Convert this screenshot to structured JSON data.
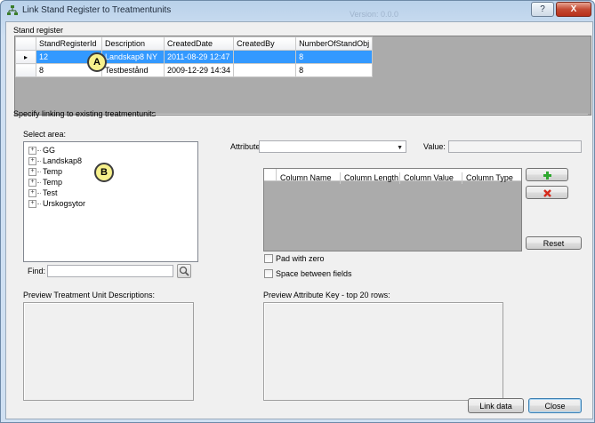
{
  "window": {
    "title": "Link Stand Register to Treatmentunits",
    "version": "Version: 0.0.0",
    "help_label": "?",
    "close_label": "X"
  },
  "stand_register": {
    "label": "Stand register",
    "columns": [
      "StandRegisterId",
      "Description",
      "CreatedDate",
      "CreatedBy",
      "NumberOfStandObj"
    ],
    "rows": [
      {
        "indicator": "▸",
        "id": "12",
        "description": "Landskap8 NY",
        "created_date": "2011-08-29 12:47",
        "created_by": "",
        "count": "8"
      },
      {
        "indicator": "",
        "id": "8",
        "description": "Testbestånd",
        "created_date": "2009-12-29 14:34",
        "created_by": "",
        "count": "8"
      }
    ]
  },
  "callouts": {
    "a": "A",
    "b": "B"
  },
  "linking": {
    "label": "Specify linking to existing treatmentunits",
    "select_area_label": "Select area:",
    "tree": [
      {
        "expander": "+",
        "label": "GG"
      },
      {
        "expander": "+",
        "label": "Landskap8"
      },
      {
        "expander": "+",
        "label": "Temp"
      },
      {
        "expander": "+",
        "label": "Temp"
      },
      {
        "expander": "+",
        "label": "Test"
      },
      {
        "expander": "+",
        "label": "Urskogsytor"
      }
    ],
    "find_label": "Find:",
    "find_value": "",
    "attribute_label": "Attribute:",
    "attribute_value": "",
    "value_label": "Value:",
    "value_value": "",
    "columns_grid": [
      "Column Name",
      "Column Length",
      "Column Value",
      "Column Type"
    ],
    "reset_label": "Reset",
    "pad_with_zero_label": "Pad with zero",
    "pad_with_zero_checked": false,
    "space_between_label": "Space between fields",
    "space_between_checked": false,
    "preview_desc_label": "Preview Treatment Unit Descriptions:",
    "preview_key_label": "Preview Attribute Key - top 20 rows:"
  },
  "footer": {
    "link_label": "Link data",
    "close_label": "Close"
  },
  "colors": {
    "selection": "#3399ff",
    "grid_background": "#ababab",
    "callout_fill": "#f7f18c",
    "add_icon": "#2fa82f",
    "remove_icon": "#d62a1c"
  },
  "icons": {
    "app": "tree-network-icon",
    "add": "plus-icon",
    "remove": "x-icon",
    "find": "magnifier-icon",
    "dropdown": "chevron-down-icon"
  }
}
